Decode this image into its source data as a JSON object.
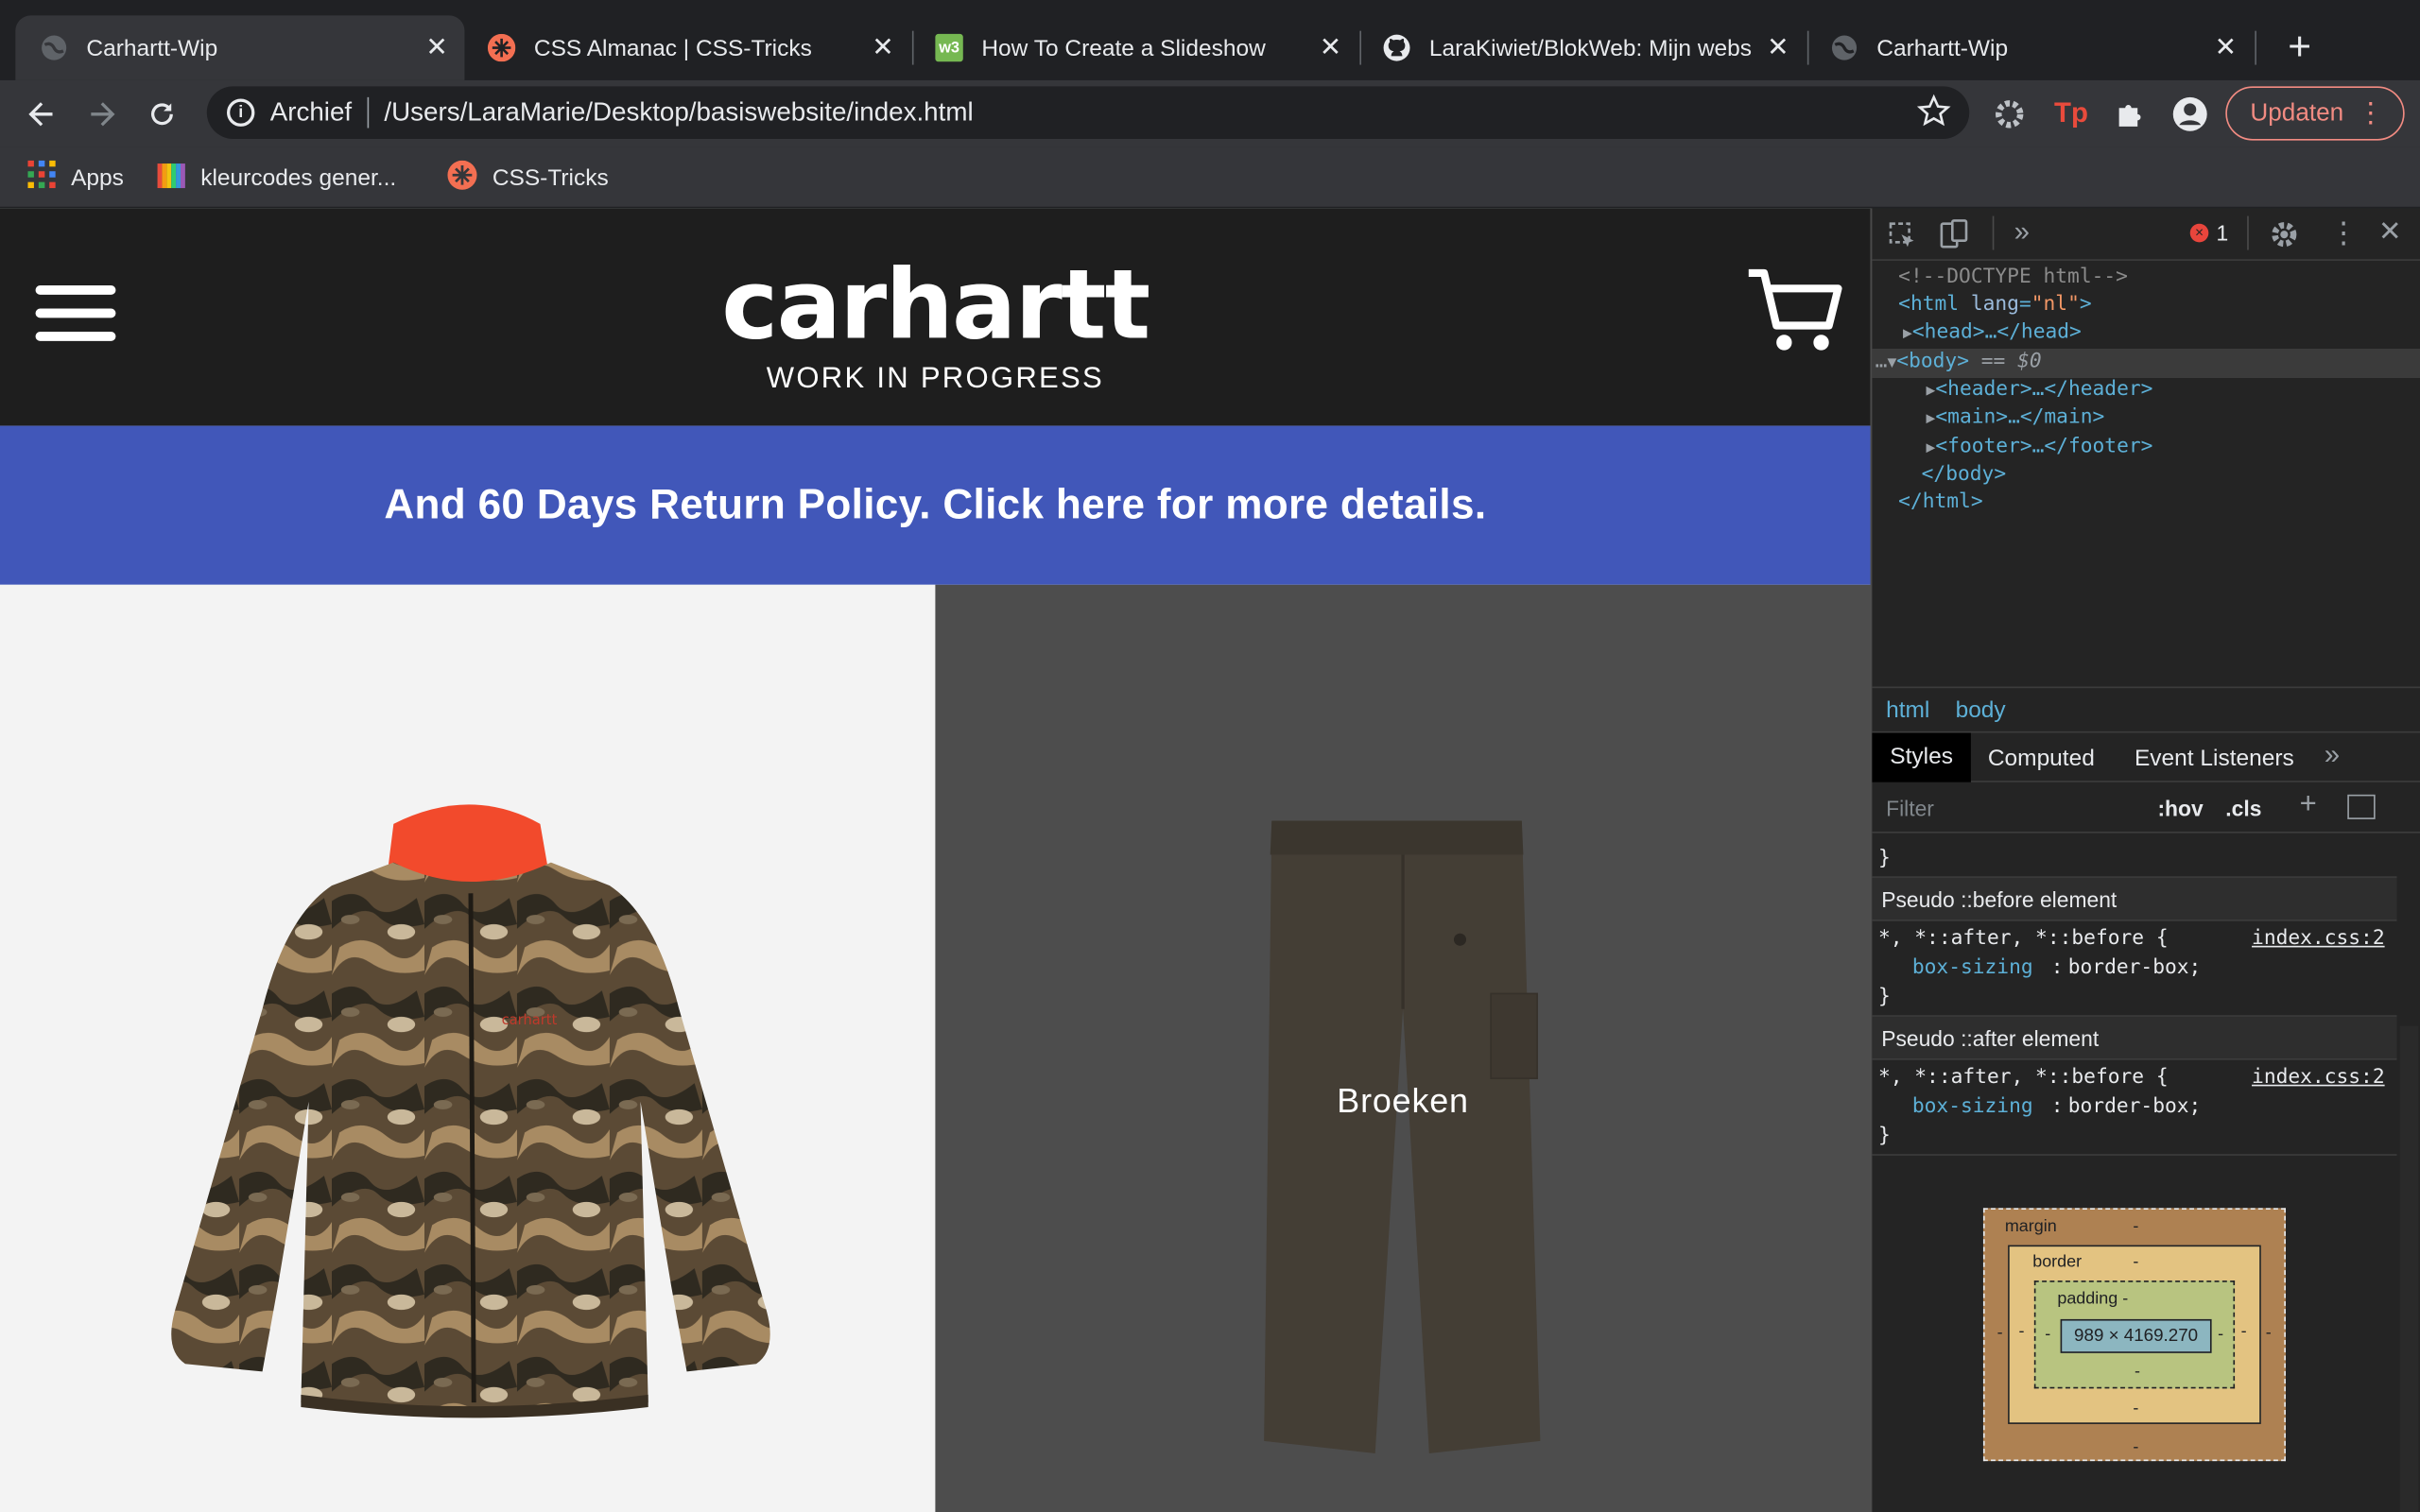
{
  "browser": {
    "tabs": [
      {
        "title": "Carhartt-Wip",
        "active": true
      },
      {
        "title": "CSS Almanac | CSS-Tricks",
        "active": false
      },
      {
        "title": "How To Create a Slideshow",
        "active": false
      },
      {
        "title": "LaraKiwiet/BlokWeb: Mijn webs",
        "active": false
      },
      {
        "title": "Carhartt-Wip",
        "active": false
      }
    ],
    "new_tab": "+",
    "address_prefix": "Archief",
    "address_url": "/Users/LaraMarie/Desktop/basiswebsite/index.html",
    "update_label": "Updaten",
    "bookmarks": [
      "Apps",
      "kleurcodes gener...",
      "CSS-Tricks"
    ]
  },
  "site": {
    "logo_main": "carhartt",
    "logo_sub": "WORK IN PROGRESS",
    "banner": "And 60 Days Return Policy. Click here for more details.",
    "panels": [
      {
        "label": ""
      },
      {
        "label": "Broeken"
      }
    ]
  },
  "devtools": {
    "error_count": "1",
    "dom": [
      "<!--DOCTYPE html-->",
      "<html lang=\"nl\">",
      "<head>…</head>",
      "<body> == $0",
      "<header>…</header>",
      "<main>…</main>",
      "<footer>…</footer>",
      "</body>",
      "</html>"
    ],
    "breadcrumbs": [
      "html",
      "body"
    ],
    "panel_tabs": [
      "Styles",
      "Computed",
      "Event Listeners"
    ],
    "filter_placeholder": "Filter",
    "hov": ":hov",
    "cls": ".cls",
    "pseudo_before": "Pseudo ::before element",
    "pseudo_after": "Pseudo ::after element",
    "rule_selector": "*, *::after, *::before {",
    "rule_prop": "box-sizing",
    "rule_value": "border-box;",
    "rule_source": "index.css:2",
    "box_model": {
      "margin": "margin",
      "border": "border",
      "padding": "padding -",
      "content": "989 × 4169.270",
      "dash": "-"
    }
  },
  "colors": {
    "banner": "#4157b9",
    "header": "#1e1e1e",
    "update_accent": "#f28b82"
  }
}
